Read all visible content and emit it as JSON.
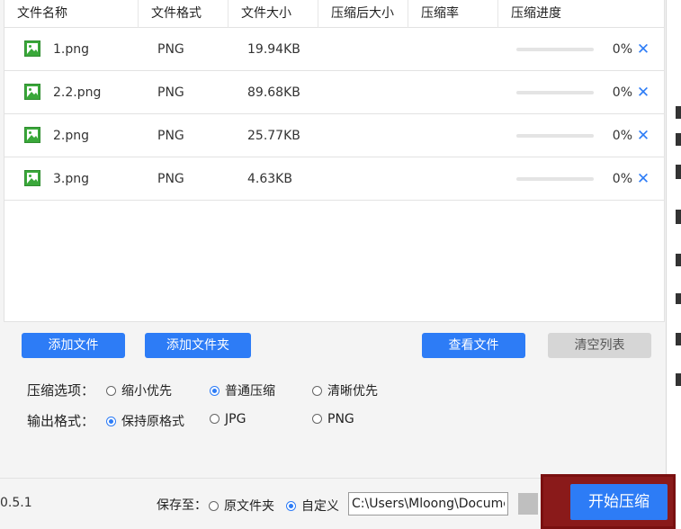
{
  "table": {
    "columns": [
      "文件名称",
      "文件格式",
      "文件大小",
      "压缩后大小",
      "压缩率",
      "压缩进度"
    ],
    "rows": [
      {
        "name": "1.png",
        "format": "PNG",
        "size": "19.94KB",
        "compressed_size": "",
        "ratio": "",
        "progress": 0,
        "progress_text": "0%",
        "remove": "✕"
      },
      {
        "name": "2.2.png",
        "format": "PNG",
        "size": "89.68KB",
        "compressed_size": "",
        "ratio": "",
        "progress": 0,
        "progress_text": "0%",
        "remove": "✕"
      },
      {
        "name": "2.png",
        "format": "PNG",
        "size": "25.77KB",
        "compressed_size": "",
        "ratio": "",
        "progress": 0,
        "progress_text": "0%",
        "remove": "✕"
      },
      {
        "name": "3.png",
        "format": "PNG",
        "size": "4.63KB",
        "compressed_size": "",
        "ratio": "",
        "progress": 0,
        "progress_text": "0%",
        "remove": "✕"
      }
    ],
    "row_icon": "image-file-icon"
  },
  "toolbar": {
    "add_files": "添加文件",
    "add_folder": "添加文件夹",
    "view_files": "查看文件",
    "clear_list": "清空列表"
  },
  "options": {
    "compression_label": "压缩选项：",
    "compression_choices": [
      {
        "label": "缩小优先",
        "selected": false
      },
      {
        "label": "普通压缩",
        "selected": true
      },
      {
        "label": "清晰优先",
        "selected": false
      }
    ],
    "output_label": "输出格式：",
    "output_choices": [
      {
        "label": "保持原格式",
        "selected": true
      },
      {
        "label": "JPG",
        "selected": false
      },
      {
        "label": "PNG",
        "selected": false
      }
    ]
  },
  "footer": {
    "version": "0.5.1",
    "save_to_label": "保存至：",
    "save_choices": [
      {
        "label": "原文件夹",
        "selected": false
      },
      {
        "label": "自定义",
        "selected": true
      }
    ],
    "path_value": "C:\\Users\\Mloong\\Documents",
    "start_button": "开始压缩"
  },
  "colors": {
    "accent": "#2d7cf6",
    "disabled": "#d6d6d6",
    "icon_green": "#3aa83a"
  }
}
